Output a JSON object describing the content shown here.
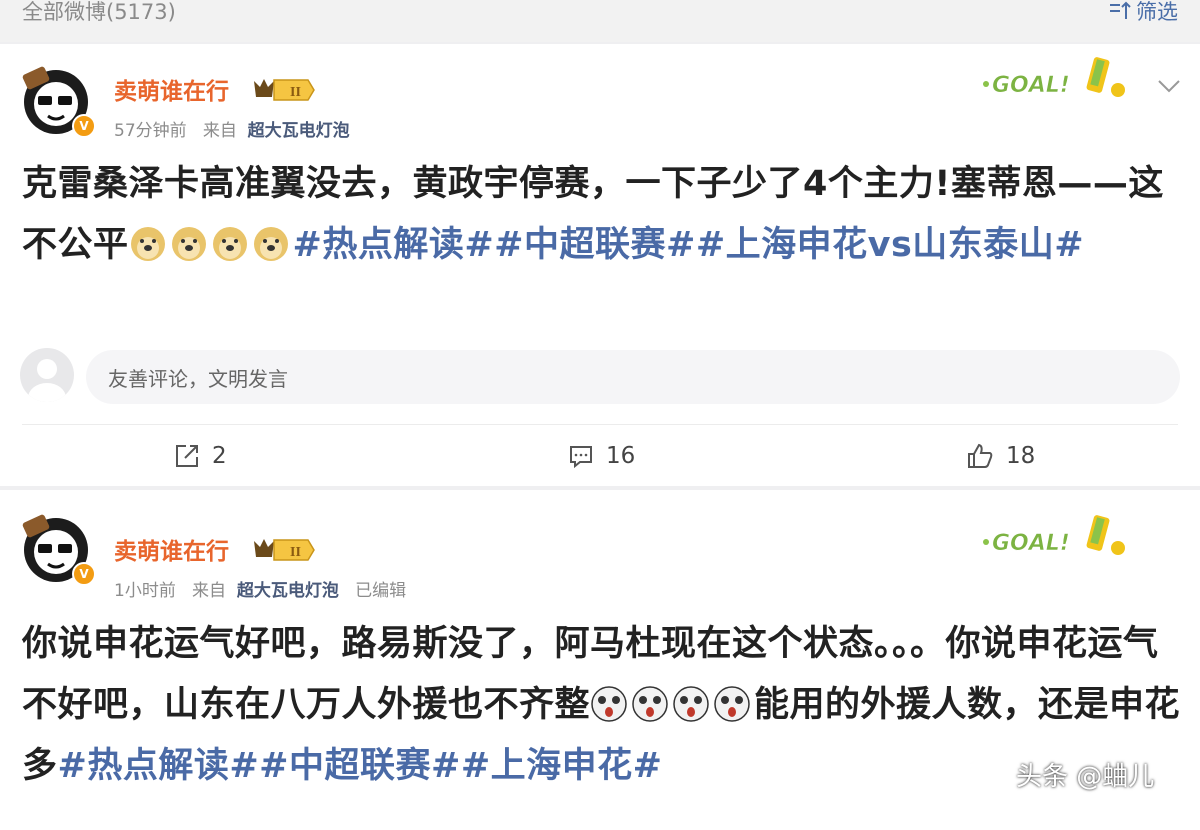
{
  "header": {
    "count_label": "全部微博(5173)",
    "filter_label": "筛选"
  },
  "posts": [
    {
      "username": "卖萌谁在行",
      "level_badge": "II",
      "time": "57分钟前",
      "from_prefix": "来自",
      "source": "超大瓦电灯泡",
      "edited": "",
      "text_part1": "克雷桑泽卡高准翼没去，黄政宇停赛，一下子少了4个主力!塞蒂恩——这不公平",
      "tags": "#热点解读##中超联赛##上海申花vs山东泰山#",
      "comment_placeholder": "友善评论，文明发言",
      "reposts": "2",
      "comments": "16",
      "likes": "18"
    },
    {
      "username": "卖萌谁在行",
      "level_badge": "II",
      "time": "1小时前",
      "from_prefix": "来自",
      "source": "超大瓦电灯泡",
      "edited": "已编辑",
      "text_part1": "你说申花运气好吧，路易斯没了，阿马杜现在这个状态。。。你说申花运气不好吧，山东在八万人外援也不齐整",
      "text_part2": "能用的外援人数，还是申花多",
      "tags": "#热点解读##中超联赛##上海申花#"
    }
  ],
  "sticker": {
    "text": "GOAL!"
  },
  "watermark": "头条 @蛐儿",
  "colors": {
    "username": "#e8652c",
    "topic": "#4a6aa6",
    "source": "#4a5a7a",
    "badge": "#f39c12"
  }
}
